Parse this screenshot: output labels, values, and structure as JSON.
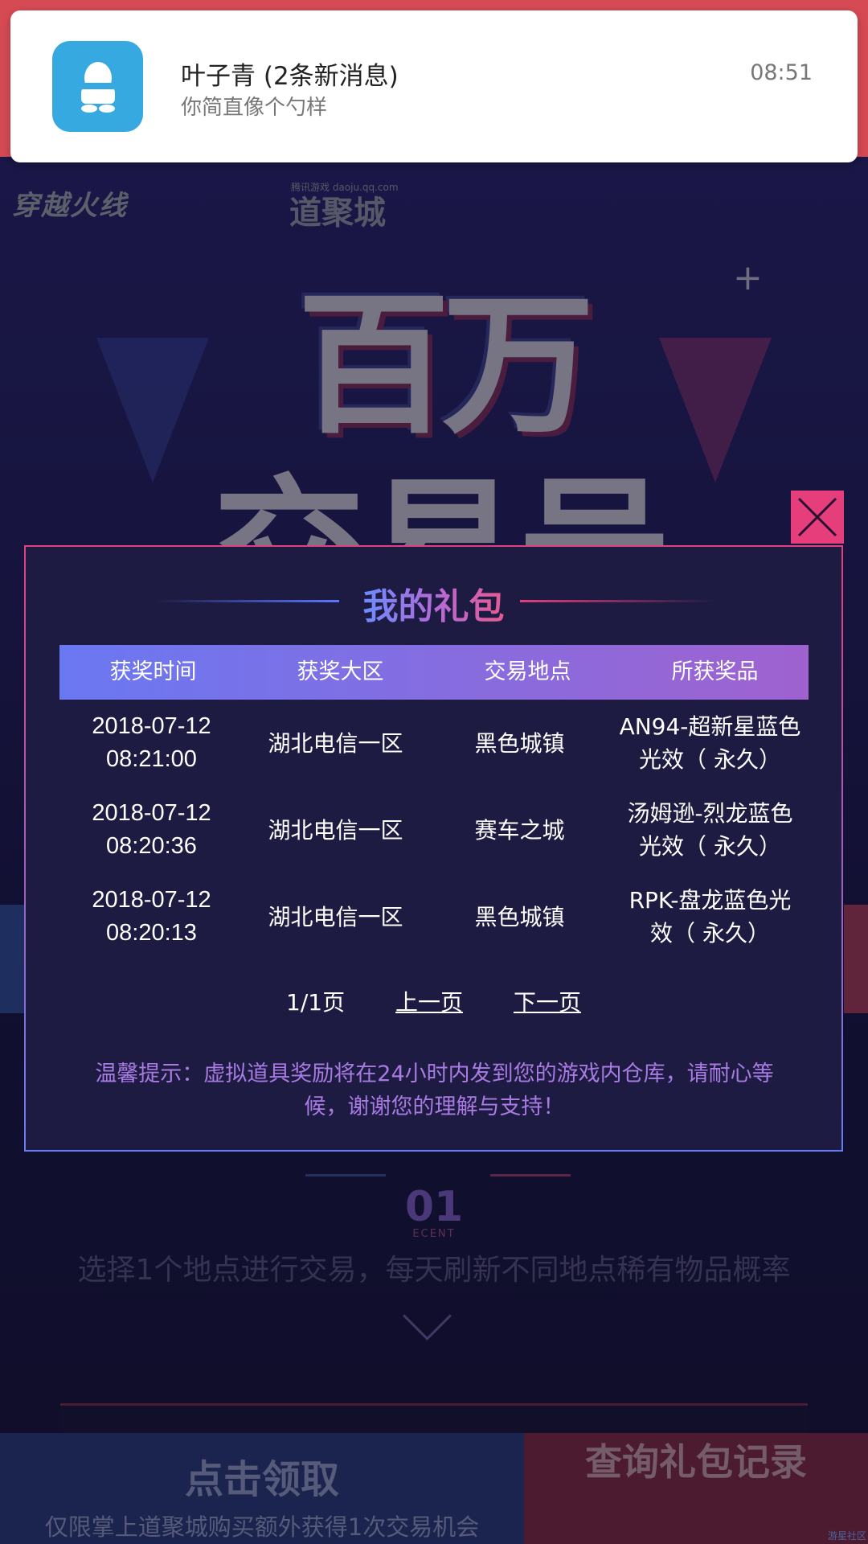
{
  "notification": {
    "title": "叶子青 (2条新消息)",
    "message": "你简直像个勺样",
    "time": "08:51",
    "icon": "qq-penguin-icon",
    "icon_bg": "#36a9e1"
  },
  "background": {
    "logo_cf": "穿越火线",
    "logo_djc": "道聚城",
    "logo_djc_sub": "腾讯游戏 daoju.qq.com",
    "hero_line1": "百万",
    "hero_line2": "交易号",
    "ecent_big": "01",
    "ecent_small": "ECENT",
    "description": "选择1个地点进行交易，每天刷新不同地点稀有物品概率",
    "claim_button": "点击领取",
    "claim_subtitle": "仅限掌上道聚城购买额外获得1次交易机会",
    "record_button": "查询礼包记录",
    "watermark": "游星社区"
  },
  "modal": {
    "title": "我的礼包",
    "columns": [
      "获奖时间",
      "获奖大区",
      "交易地点",
      "所获奖品"
    ],
    "rows": [
      {
        "time_date": "2018-07-12",
        "time_clock": "08:21:00",
        "region": "湖北电信一区",
        "location": "黑色城镇",
        "prize_line1": "AN94-超新星蓝色",
        "prize_line2": "光效（ 永久）"
      },
      {
        "time_date": "2018-07-12",
        "time_clock": "08:20:36",
        "region": "湖北电信一区",
        "location": "赛车之城",
        "prize_line1": "汤姆逊-烈龙蓝色",
        "prize_line2": "光效（ 永久）"
      },
      {
        "time_date": "2018-07-12",
        "time_clock": "08:20:13",
        "region": "湖北电信一区",
        "location": "黑色城镇",
        "prize_line1": "RPK-盘龙蓝色光",
        "prize_line2": "效（ 永久）"
      }
    ],
    "page_indicator": "1/1页",
    "prev_page": "上一页",
    "next_page": "下一页",
    "tip_line1": "温馨提示：虚拟道具奖励将在24小时内发到您的游戏内仓库，请耐心等",
    "tip_line2": "候，谢谢您的理解与支持！",
    "close_icon": "close-x-icon",
    "accent_colors": [
      "#6a78f2",
      "#9f62cf",
      "#e63e7a"
    ]
  }
}
